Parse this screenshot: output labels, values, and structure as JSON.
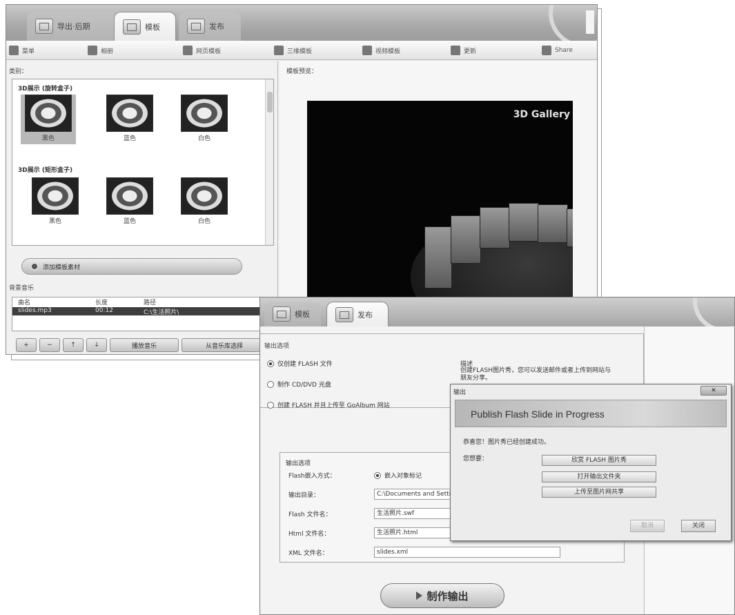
{
  "back_window": {
    "tabs": [
      {
        "label": "导出·后期",
        "active": false,
        "icon": "import-icon"
      },
      {
        "label": "模板",
        "active": true,
        "icon": "template-icon"
      },
      {
        "label": "发布",
        "active": false,
        "icon": "publish-icon"
      }
    ],
    "toolbar": [
      {
        "label": "菜单",
        "icon": "menu-icon"
      },
      {
        "label": "相册",
        "icon": "camera-icon"
      },
      {
        "label": "网页模板",
        "icon": "webpage-icon"
      },
      {
        "label": "三维模板",
        "icon": "3d-icon"
      },
      {
        "label": "视频模板",
        "icon": "video-icon"
      },
      {
        "label": "更新",
        "icon": "update-icon"
      },
      {
        "label": "Share",
        "icon": "share-icon"
      }
    ],
    "category_label": "类别：",
    "groups": [
      {
        "title": "3D展示 (旋转盒子)",
        "items": [
          "黑色",
          "蓝色",
          "白色"
        ]
      },
      {
        "title": "3D展示 (矩形盒子)",
        "items": [
          "黑色",
          "蓝色",
          "白色"
        ]
      }
    ],
    "pill_button": "添加模板素材",
    "music": {
      "section_label": "背景音乐",
      "headers": [
        "曲名",
        "长度",
        "路径"
      ],
      "row": [
        "slides.mp3",
        "00:12",
        "C:\\生活照片\\"
      ]
    },
    "music_buttons": [
      "+",
      "−",
      "↑",
      "↓",
      "播放音乐",
      "从音乐库选择"
    ],
    "preview_label": "模板预览：",
    "preview_title": "3D Gallery"
  },
  "front_window": {
    "tabs": [
      {
        "label": "模板",
        "active": false,
        "icon": "template-icon"
      },
      {
        "label": "发布",
        "active": true,
        "icon": "publish-icon"
      }
    ],
    "output_options_label": "输出选项",
    "radio_options": [
      {
        "label": "仅创建 FLASH 文件",
        "checked": true
      },
      {
        "label": "制作 CD/DVD 光盘",
        "checked": false
      },
      {
        "label": "创建 FLASH 并且上传至 GoAlbum 网站",
        "checked": false
      }
    ],
    "description_label": "描述",
    "description_text": "创建FLASH图片秀，您可以发送邮件或者上传到网站与朋友分享。",
    "settings": {
      "title": "输出选项",
      "rows": [
        {
          "label": "Flash嵌入方式：",
          "value": "嵌入对象标记",
          "kind": "radio"
        },
        {
          "label": "输出目录：",
          "value": "C:\\Documents and Settings\\",
          "kind": "input"
        },
        {
          "label": "Flash 文件名：",
          "value": "生活照片.swf",
          "kind": "input"
        },
        {
          "label": "Html 文件名：",
          "value": "生活照片.html",
          "kind": "input"
        },
        {
          "label": "XML 文件名：",
          "value": "slides.xml",
          "kind": "input"
        }
      ]
    },
    "make_button": "制作输出"
  },
  "dialog": {
    "title": "输出",
    "close_label": "",
    "banner": "Publish Flash Slide in Progress",
    "message": "恭喜您！图片秀已经创建成功。",
    "options_label": "您想要：",
    "buttons": [
      "欣赏 FLASH 图片秀",
      "打开输出文件夹",
      "上传至图片网共享"
    ],
    "footer_buttons": [
      {
        "label": "取消",
        "disabled": true
      },
      {
        "label": "关闭",
        "disabled": false
      }
    ]
  }
}
